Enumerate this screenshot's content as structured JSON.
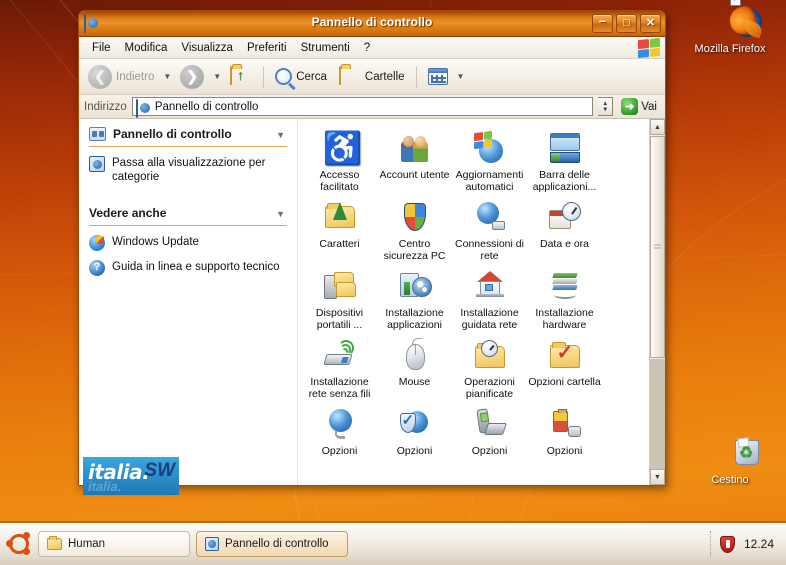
{
  "desktop": {
    "icons": [
      {
        "name": "firefox",
        "label": "Mozilla Firefox"
      },
      {
        "name": "recycle-bin",
        "label": "Cestino"
      }
    ]
  },
  "window": {
    "title": "Pannello di controllo",
    "title_icon": "control-panel-icon",
    "buttons": {
      "minimize": "–",
      "maximize": "□",
      "close": "✕"
    },
    "menu": [
      "File",
      "Modifica",
      "Visualizza",
      "Preferiti",
      "Strumenti",
      "?"
    ],
    "toolbar": {
      "back": "Indietro",
      "forward": "",
      "up": "",
      "search": "Cerca",
      "folders": "Cartelle",
      "views": ""
    },
    "address": {
      "label": "Indirizzo",
      "value": "Pannello di controllo",
      "go": "Vai"
    }
  },
  "sidebar": {
    "panel_title": "Pannello di controllo",
    "switch_link": "Passa alla visualizzazione per categorie",
    "see_also_title": "Vedere anche",
    "links": [
      {
        "icon": "windows-update-icon",
        "label": "Windows Update"
      },
      {
        "icon": "help-icon",
        "label": "Guida in linea e supporto tecnico"
      }
    ]
  },
  "content": {
    "items": [
      {
        "art": "accessibility",
        "label": "Accesso facilitato"
      },
      {
        "art": "user-accounts",
        "label": "Account utente"
      },
      {
        "art": "auto-updates",
        "label": "Aggiornamenti automatici"
      },
      {
        "art": "taskbar",
        "label": "Barra delle applicazioni..."
      },
      {
        "art": "fonts",
        "label": "Caratteri"
      },
      {
        "art": "security-center",
        "label": "Centro sicurezza PC"
      },
      {
        "art": "network-connections",
        "label": "Connessioni di rete"
      },
      {
        "art": "date-time",
        "label": "Data e ora"
      },
      {
        "art": "portable-devices",
        "label": "Dispositivi portatili ..."
      },
      {
        "art": "add-remove-programs",
        "label": "Installazione applicazioni"
      },
      {
        "art": "network-setup-wizard",
        "label": "Installazione guidata rete"
      },
      {
        "art": "add-hardware",
        "label": "Installazione hardware"
      },
      {
        "art": "wireless-network-setup",
        "label": "Installazione rete senza fili"
      },
      {
        "art": "mouse",
        "label": "Mouse"
      },
      {
        "art": "scheduled-tasks",
        "label": "Operazioni pianificate"
      },
      {
        "art": "folder-options",
        "label": "Opzioni cartella"
      },
      {
        "art": "internet-options",
        "label": "Opzioni"
      },
      {
        "art": "internet-options-2",
        "label": "Opzioni"
      },
      {
        "art": "phone-modem-options",
        "label": "Opzioni"
      },
      {
        "art": "power-options",
        "label": "Opzioni"
      }
    ]
  },
  "watermark": {
    "text": "italia.",
    "mark": "SW"
  },
  "taskbar": {
    "start_icon": "ubuntu-logo",
    "tasks": [
      {
        "icon": "folder-icon",
        "label": "Human",
        "active": false
      },
      {
        "icon": "control-panel-icon",
        "label": "Pannello di controllo",
        "active": true
      }
    ],
    "tray": {
      "shield_icon": "security-shield-icon",
      "clock": "12.24"
    }
  },
  "colors": {
    "accent": "#e8820c",
    "title_bar": "#df8119",
    "desktop_top": "#6a1a08",
    "desktop_bottom": "#e87d0d",
    "watermark_bg": "#2b8fcc"
  }
}
